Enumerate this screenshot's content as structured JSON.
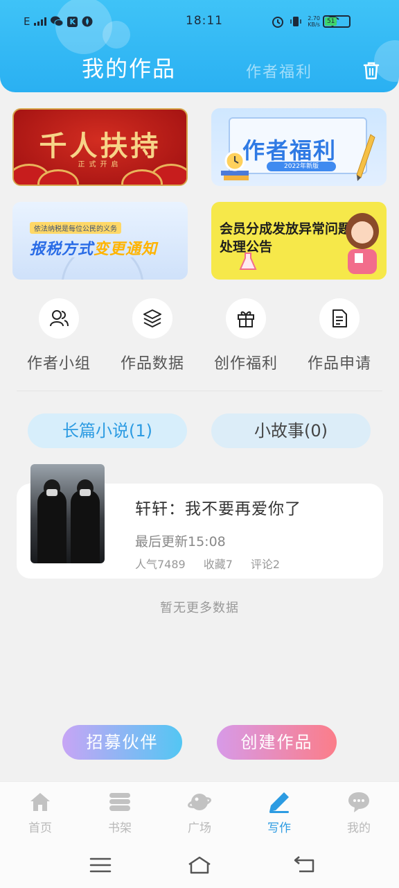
{
  "status_bar": {
    "time": "18:11",
    "network": "E",
    "k_badge": "K",
    "speed_value": "2.70",
    "speed_unit": "KB/s",
    "battery": "51"
  },
  "header": {
    "tab_my_works": "我的作品",
    "tab_author_welfare": "作者福利",
    "trash_icon": "trash-icon",
    "accent": "#2ab0f2"
  },
  "banners": [
    {
      "title": "千人扶持",
      "subtitle": "正式开启"
    },
    {
      "title": "作者福利",
      "badge": "2022年新版"
    },
    {
      "tag": "依法纳税是每位公民的义务",
      "title_a": "报税方式",
      "title_b": "变更通知"
    },
    {
      "title": "会员分成发放异常问题处理公告"
    }
  ],
  "quick_menu": [
    {
      "label": "作者小组",
      "icon": "users-icon"
    },
    {
      "label": "作品数据",
      "icon": "layers-icon"
    },
    {
      "label": "创作福利",
      "icon": "gift-icon"
    },
    {
      "label": "作品申请",
      "icon": "document-icon"
    }
  ],
  "segments": {
    "novel": "长篇小说(1)",
    "story": "小故事(0)"
  },
  "work": {
    "title": "轩轩：我不要再爱你了",
    "updated": "最后更新15:08",
    "popularity": "人气7489",
    "favorites": "收藏7",
    "comments": "评论2"
  },
  "no_more": "暂无更多数据",
  "actions": {
    "recruit": "招募伙伴",
    "create": "创建作品"
  },
  "tabbar": [
    {
      "label": "首页",
      "icon": "home-icon"
    },
    {
      "label": "书架",
      "icon": "bookshelf-icon"
    },
    {
      "label": "广场",
      "icon": "planet-icon"
    },
    {
      "label": "写作",
      "icon": "pen-icon"
    },
    {
      "label": "我的",
      "icon": "chat-icon"
    }
  ],
  "active_tab": "写作",
  "active_color": "#2c9be2"
}
